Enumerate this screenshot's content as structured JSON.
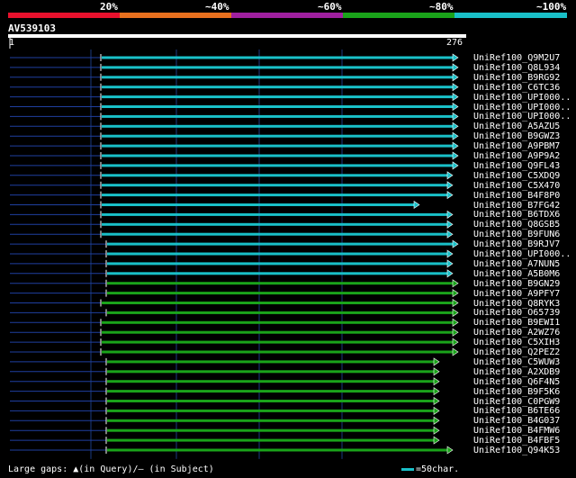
{
  "legend": [
    {
      "label": "20%",
      "color": "#e8112d"
    },
    {
      "label": "~40%",
      "color": "#e8701e"
    },
    {
      "label": "~60%",
      "color": "#a020a0"
    },
    {
      "label": "~80%",
      "color": "#1aa31a"
    },
    {
      "label": "~100%",
      "color": "#19c0c8"
    }
  ],
  "query": {
    "id": "AV539103",
    "start": "1",
    "end": "276"
  },
  "hits": [
    {
      "name": "UniRef100_Q9M2U7",
      "color": "#19c0c8"
    },
    {
      "name": "UniRef100_Q8L934",
      "color": "#19c0c8"
    },
    {
      "name": "UniRef100_B9RG92",
      "color": "#19c0c8"
    },
    {
      "name": "UniRef100_C6TC36",
      "color": "#19c0c8"
    },
    {
      "name": "UniRef100_UPI000..",
      "color": "#19c0c8"
    },
    {
      "name": "UniRef100_UPI000..",
      "color": "#19c0c8"
    },
    {
      "name": "UniRef100_UPI000..",
      "color": "#19c0c8"
    },
    {
      "name": "UniRef100_A5AZU5",
      "color": "#19c0c8"
    },
    {
      "name": "UniRef100_B9GWZ3",
      "color": "#19c0c8"
    },
    {
      "name": "UniRef100_A9PBM7",
      "color": "#19c0c8"
    },
    {
      "name": "UniRef100_A9P9A2",
      "color": "#19c0c8"
    },
    {
      "name": "UniRef100_Q9FL43",
      "color": "#19c0c8"
    },
    {
      "name": "UniRef100_C5XDQ9",
      "color": "#19c0c8"
    },
    {
      "name": "UniRef100_C5X470",
      "color": "#19c0c8"
    },
    {
      "name": "UniRef100_B4F8P0",
      "color": "#19c0c8"
    },
    {
      "name": "UniRef100_B7FG42",
      "color": "#19c0c8"
    },
    {
      "name": "UniRef100_B6TDX6",
      "color": "#19c0c8"
    },
    {
      "name": "UniRef100_Q8GSB5",
      "color": "#19c0c8"
    },
    {
      "name": "UniRef100_B9FUN6",
      "color": "#19c0c8"
    },
    {
      "name": "UniRef100_B9RJV7",
      "color": "#19c0c8"
    },
    {
      "name": "UniRef100_UPI000..",
      "color": "#19c0c8"
    },
    {
      "name": "UniRef100_A7NUN5",
      "color": "#19c0c8"
    },
    {
      "name": "UniRef100_A5B0M6",
      "color": "#19c0c8"
    },
    {
      "name": "UniRef100_B9GN29",
      "color": "#1aa31a"
    },
    {
      "name": "UniRef100_A9PFY7",
      "color": "#1aa31a"
    },
    {
      "name": "UniRef100_Q8RYK3",
      "color": "#1aa31a"
    },
    {
      "name": "UniRef100_O65739",
      "color": "#1aa31a"
    },
    {
      "name": "UniRef100_B9EWI1",
      "color": "#1aa31a"
    },
    {
      "name": "UniRef100_A2WZ76",
      "color": "#1aa31a"
    },
    {
      "name": "UniRef100_C5XIH3",
      "color": "#1aa31a"
    },
    {
      "name": "UniRef100_Q2PEZ2",
      "color": "#1aa31a"
    },
    {
      "name": "UniRef100_C5WUW3",
      "color": "#1aa31a"
    },
    {
      "name": "UniRef100_A2XDB9",
      "color": "#1aa31a"
    },
    {
      "name": "UniRef100_Q6F4N5",
      "color": "#1aa31a"
    },
    {
      "name": "UniRef100_B9F5K6",
      "color": "#1aa31a"
    },
    {
      "name": "UniRef100_C0PGW9",
      "color": "#1aa31a"
    },
    {
      "name": "UniRef100_B6TE66",
      "color": "#1aa31a"
    },
    {
      "name": "UniRef100_B4G037",
      "color": "#1aa31a"
    },
    {
      "name": "UniRef100_B4FMW6",
      "color": "#1aa31a"
    },
    {
      "name": "UniRef100_B4FBF5",
      "color": "#1aa31a"
    },
    {
      "name": "UniRef100_Q94K53",
      "color": "#1aa31a"
    }
  ],
  "footer": {
    "gaps_text": "Large gaps: ▲(in Query)/— (in Subject)",
    "scale_text": "=50char."
  },
  "colors": {
    "background": "#000000",
    "gridline": "#1a3a80",
    "subject_gap": "#1f3fa0"
  }
}
